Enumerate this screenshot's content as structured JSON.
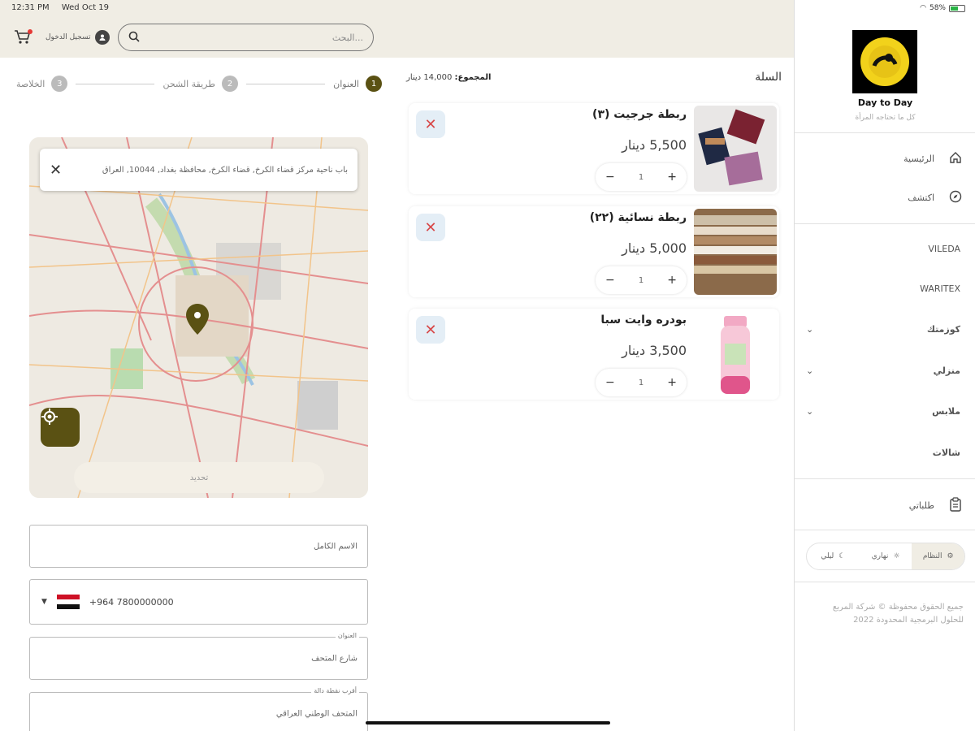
{
  "status": {
    "time": "12:31 PM",
    "date": "Wed Oct 19",
    "battery": "58%"
  },
  "header": {
    "login_label": "تسجيل الدخول",
    "search_placeholder": "البحث..."
  },
  "stepper": {
    "steps": [
      {
        "num": "1",
        "label": "العنوان"
      },
      {
        "num": "2",
        "label": "طريقة الشحن"
      },
      {
        "num": "3",
        "label": "الخلاصة"
      }
    ]
  },
  "map": {
    "address": "باب ناحية مركز قضاء الكرخ, قضاء الكرخ, محافظة بغداد, 10044, العراق",
    "confirm_label": "تحديد"
  },
  "form": {
    "full_name_placeholder": "الاسم الكامل",
    "phone_value": "+964 7800000000",
    "address_label": "العنوان",
    "address_value": "شارع المتحف",
    "landmark_label": "أقرب نقطة دالة",
    "landmark_value": "المتحف الوطني العراقي"
  },
  "cart": {
    "title": "السلة",
    "total_label": "المجموع:",
    "total_value": "14,000 دينار",
    "items": [
      {
        "name": "ربطة جرجيت (٣)",
        "price": "5,500 دينار",
        "qty": "1"
      },
      {
        "name": "ربطة نسائية (٢٢)",
        "price": "5,000 دينار",
        "qty": "1"
      },
      {
        "name": "بودره وايت سبا",
        "price": "3,500 دينار",
        "qty": "1"
      }
    ]
  },
  "sidebar": {
    "brand": "Day to Day",
    "tagline": "كل ما تحتاجه المرأة",
    "nav": [
      {
        "label": "الرئيسية",
        "icon": "home-icon"
      },
      {
        "label": "اكتشف",
        "icon": "compass-icon"
      }
    ],
    "categories": [
      {
        "label": "VILEDA",
        "expandable": false
      },
      {
        "label": "WARITEX",
        "expandable": false
      },
      {
        "label": "كوزمتك",
        "expandable": true
      },
      {
        "label": "منزلي",
        "expandable": true
      },
      {
        "label": "ملابس",
        "expandable": true
      },
      {
        "label": "شالات",
        "expandable": false
      }
    ],
    "orders_label": "طلباتي",
    "theme": {
      "system": "النظام",
      "light": "نهاري",
      "dark": "ليلي"
    },
    "copyright": "جميع الحقوق محفوظة © شركة المربع للحلول البرمجية المحدودة 2022"
  },
  "colors": {
    "accent": "#5a5113",
    "remove": "#d84848",
    "topbar": "#f0ede4"
  }
}
